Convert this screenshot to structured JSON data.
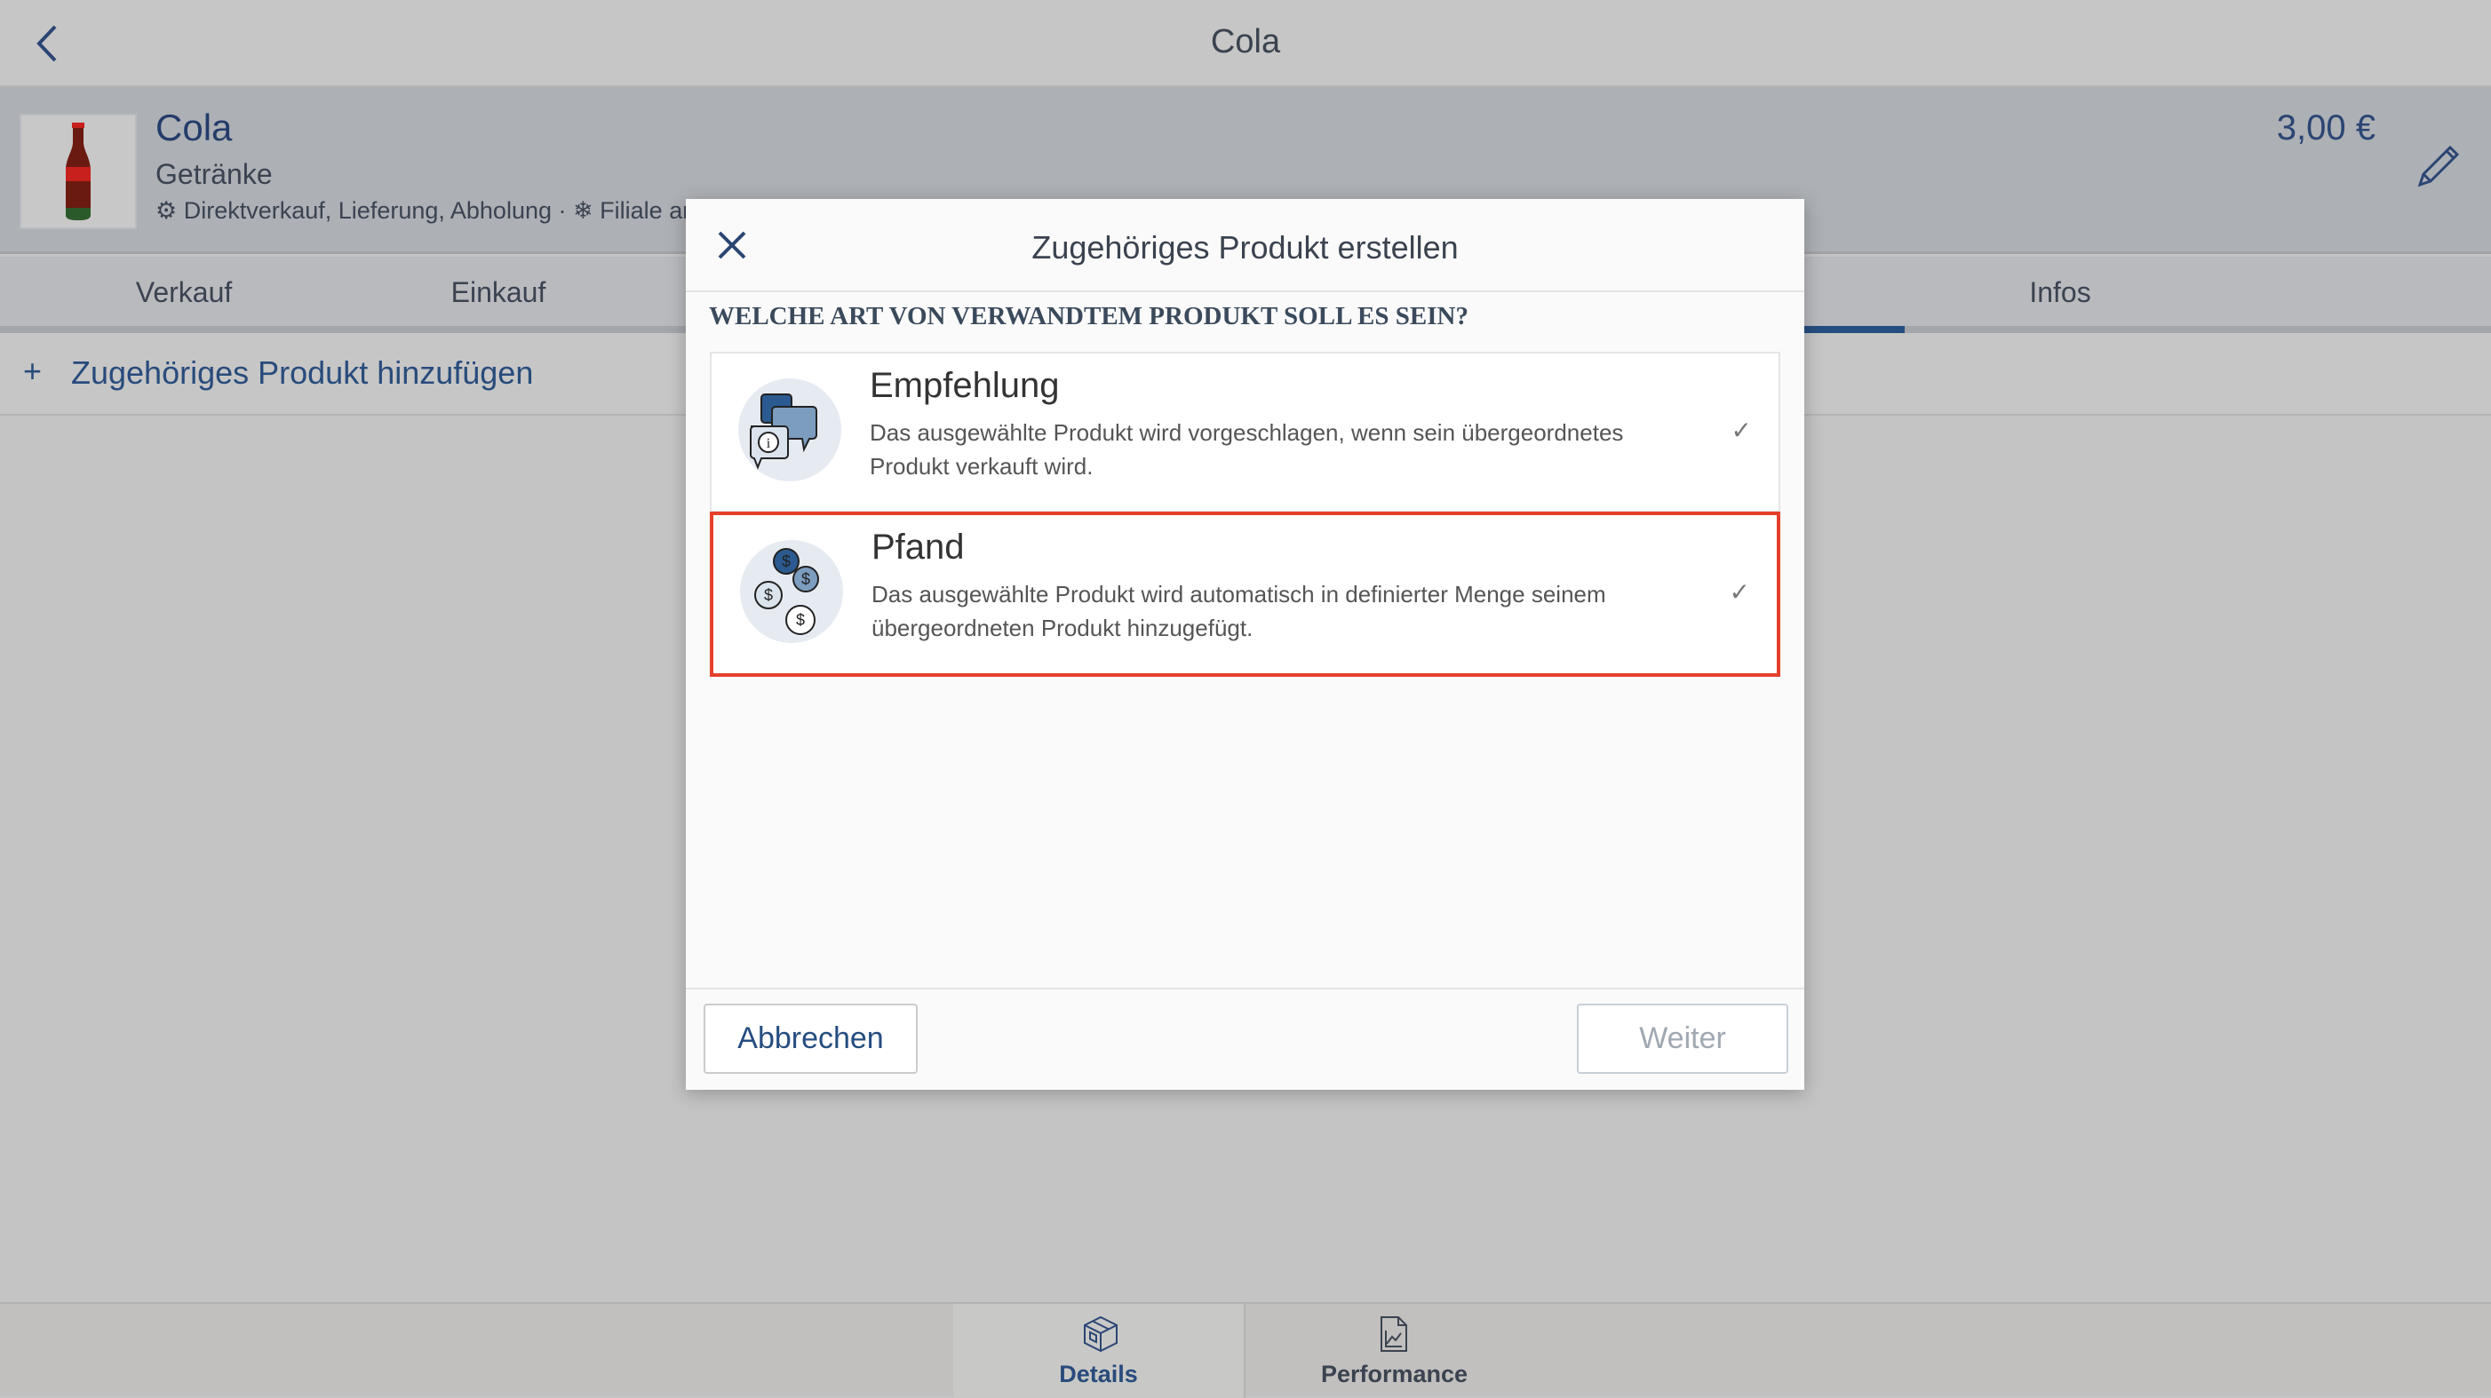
{
  "topbar": {
    "title": "Cola"
  },
  "product": {
    "name": "Cola",
    "category": "Getränke",
    "channels": "Direktverkauf, Lieferung, Abholung",
    "separator": "·",
    "branches": "Filiale an",
    "price": "3,00 €"
  },
  "tabs": [
    {
      "label": "Verkauf"
    },
    {
      "label": "Einkauf"
    },
    {
      "label": "Infos"
    }
  ],
  "add_related": {
    "label": "Zugehöriges Produkt hinzufügen"
  },
  "bottom_tabs": [
    {
      "label": "Details",
      "active": true
    },
    {
      "label": "Performance",
      "active": false
    }
  ],
  "modal": {
    "title": "Zugehöriges Produkt erstellen",
    "question": "WELCHE ART VON VERWANDTEM PRODUKT SOLL ES SEIN?",
    "options": [
      {
        "title": "Empfehlung",
        "description": "Das ausgewählte Produkt wird vorgeschlagen, wenn sein übergeordnetes Produkt verkauft wird.",
        "icon": "speech-bubbles-info-icon",
        "check": "✓"
      },
      {
        "title": "Pfand",
        "description": "Das ausgewählte Produkt wird automatisch in definierter Menge seinem übergeordneten Produkt hinzugefügt.",
        "icon": "coins-icon",
        "check": "✓",
        "highlighted": true
      }
    ],
    "cancel_label": "Abbrechen",
    "next_label": "Weiter"
  },
  "colors": {
    "accent": "#254d80",
    "highlight": "#e5402c"
  }
}
